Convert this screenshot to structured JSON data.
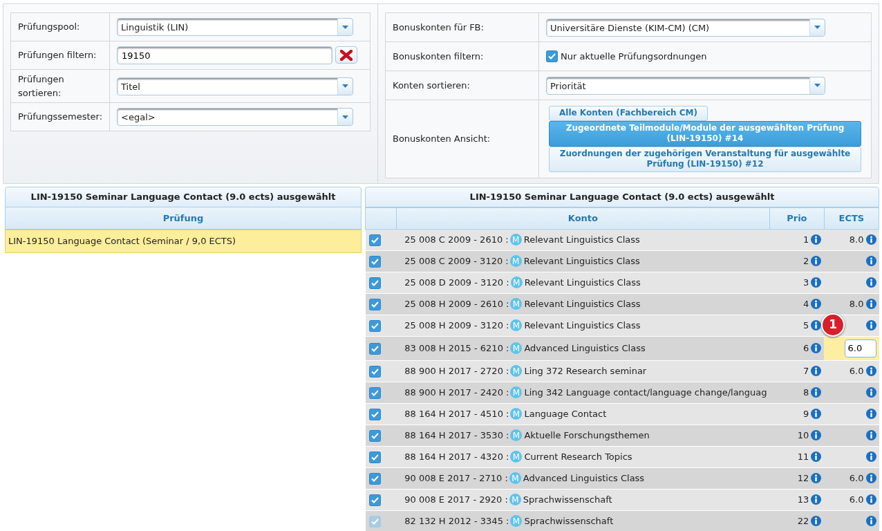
{
  "filters_left": [
    {
      "label": "Prüfungspool:",
      "kind": "select",
      "value": "Linguistik (LIN)"
    },
    {
      "label": "Prüfungen filtern:",
      "kind": "text",
      "value": "19150"
    },
    {
      "label": "Prüfungen sortieren:",
      "kind": "select",
      "value": "Titel"
    },
    {
      "label": "Prüfungssemester:",
      "kind": "select",
      "value": "<egal>"
    }
  ],
  "filters_right": [
    {
      "label": "Bonuskonten für FB:",
      "kind": "select",
      "value": "Universitäre Dienste (KIM-CM) (CM)"
    },
    {
      "label": "Bonuskonten filtern:",
      "kind": "checkbox",
      "checked": true,
      "text": "Nur aktuelle Prüfungsordnungen"
    },
    {
      "label": "Konten sortieren:",
      "kind": "select",
      "value": "Priorität"
    },
    {
      "label": "Bonuskonten Ansicht:",
      "kind": "views",
      "views": [
        {
          "label": "Alle Konten (Fachbereich CM)",
          "selected": false
        },
        {
          "label": "Zugeordnete Teilmodule/Module der ausgewählten Prüfung (LIN-19150) #14",
          "selected": true
        },
        {
          "label": "Zuordnungen der zugehörigen Veranstaltung für ausgewählte Prüfung (LIN-19150) #12",
          "selected": false
        }
      ]
    }
  ],
  "exams": {
    "title": "LIN-19150 Seminar Language Contact (9.0 ects) ausgewählt",
    "column": "Prüfung",
    "items": [
      {
        "label": "LIN-19150 Language Contact (Seminar / 9,0 ECTS)",
        "selected": true
      }
    ]
  },
  "accounts": {
    "title": "LIN-19150 Seminar Language Contact (9.0 ects) ausgewählt",
    "columns": [
      "Konto",
      "Prio",
      "ECTS"
    ],
    "marker": "1",
    "rows": [
      {
        "checked": true,
        "disabled": false,
        "code": "25 008 C 2009 - 2610 :",
        "badge": "M",
        "name": "Relevant Linguistics Class",
        "prio": "1",
        "kind": "text",
        "ects": "8.0"
      },
      {
        "checked": true,
        "disabled": false,
        "code": "25 008 C 2009 - 3120 :",
        "badge": "M",
        "name": "Relevant Linguistics Class",
        "prio": "2",
        "kind": "text"
      },
      {
        "checked": true,
        "disabled": false,
        "code": "25 008 D 2009 - 3120 :",
        "badge": "M",
        "name": "Relevant Linguistics Class",
        "prio": "3",
        "kind": "text"
      },
      {
        "checked": true,
        "disabled": false,
        "code": "25 008 H 2009 - 2610 :",
        "badge": "M",
        "name": "Relevant Linguistics Class",
        "prio": "4",
        "kind": "text",
        "ects": "8.0"
      },
      {
        "checked": true,
        "disabled": false,
        "code": "25 008 H 2009 - 3120 :",
        "badge": "M",
        "name": "Relevant Linguistics Class",
        "prio": "5",
        "kind": "text"
      },
      {
        "checked": true,
        "disabled": false,
        "code": "83 008 H 2015 - 6210 :",
        "badge": "M",
        "name": "Advanced Linguistics Class",
        "prio": "6",
        "kind": "input",
        "ects": "6.0"
      },
      {
        "checked": true,
        "disabled": false,
        "code": "88 900 H 2017 - 2720 :",
        "badge": "M",
        "name": "Ling 372 Research seminar",
        "prio": "7",
        "kind": "text",
        "ects": "6.0"
      },
      {
        "checked": true,
        "disabled": false,
        "code": "88 900 H 2017 - 2420 :",
        "badge": "M",
        "name": "Ling 342 Language contact/language change/languag",
        "prio": "8",
        "kind": "text"
      },
      {
        "checked": true,
        "disabled": false,
        "code": "88 164 H 2017 - 4510 :",
        "badge": "M",
        "name": "Language Contact",
        "prio": "9",
        "kind": "text"
      },
      {
        "checked": true,
        "disabled": false,
        "code": "88 164 H 2017 - 3530 :",
        "badge": "M",
        "name": "Aktuelle Forschungsthemen",
        "prio": "10",
        "kind": "text"
      },
      {
        "checked": true,
        "disabled": false,
        "code": "88 164 H 2017 - 4320 :",
        "badge": "M",
        "name": "Current Research Topics",
        "prio": "11",
        "kind": "text"
      },
      {
        "checked": true,
        "disabled": false,
        "code": "90 008 E 2017 - 2710 :",
        "badge": "M",
        "name": "Advanced Linguistics Class",
        "prio": "12",
        "kind": "text",
        "ects": "6.0"
      },
      {
        "checked": true,
        "disabled": false,
        "code": "90 008 E 2017 - 2920 :",
        "badge": "M",
        "name": "Sprachwissenschaft",
        "prio": "13",
        "kind": "text",
        "ects": "6.0"
      },
      {
        "checked": true,
        "disabled": true,
        "code": "82 132 H 2012 - 3345 :",
        "badge": "M",
        "name": "Sprachwissenschaft",
        "prio": "22",
        "kind": "text"
      }
    ]
  }
}
